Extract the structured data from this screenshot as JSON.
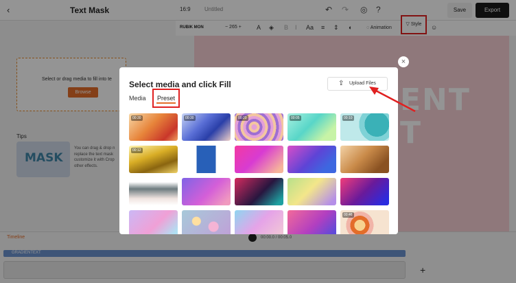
{
  "app": {
    "title": "Text Mask",
    "aspect_ratio": "16:9",
    "doc_name": "Untitled",
    "save_label": "Save",
    "export_label": "Export"
  },
  "left_panel": {
    "drop_text": "Select or drag media to fill into te",
    "browse_label": "Browse",
    "tips_title": "Tips",
    "tips_card_text": "MASK",
    "tips_text": "You can drag & drop n replace the text mask customize it with Crop other effects."
  },
  "text_toolbar": {
    "font": "RUBIK MON",
    "minus": "−",
    "size": "265",
    "plus": "+",
    "animation_label": "Animation",
    "style_label": "Style"
  },
  "canvas": {
    "text_line1": "ENT",
    "text_line2": "T"
  },
  "timeline": {
    "tools_label": "Timeline",
    "time": "00:00.0 / 00:05.0",
    "track_label": "GRADIENTEXT"
  },
  "modal": {
    "title": "Select media and click Fill",
    "upload_label": "Upload Files",
    "close_glyph": "×",
    "tabs": [
      {
        "label": "Media"
      },
      {
        "label": "Preset"
      }
    ],
    "tiles": [
      {
        "duration": "00:30",
        "bg": "linear-gradient(135deg,#f7d8a8,#e7843a 45%,#c9362a 80%,#f0a060)"
      },
      {
        "duration": "00:30",
        "bg": "linear-gradient(135deg,#c7d4f5,#5a6fd6 40%,#2a3fa8 65%,#f0d0c8)"
      },
      {
        "duration": "00:20",
        "bg": "repeating-radial-gradient(circle at 40% 50%,#e3a0d8 0 4px,#f3c6a0 4px 8px,#9f6fd2 8px 12px)"
      },
      {
        "duration": "00:05",
        "bg": "linear-gradient(135deg,#a8f0e0,#58d6c8 45%,#c7f3a6 80%)"
      },
      {
        "duration": "00:10",
        "bg": "radial-gradient(circle at 75% 40%,#3ab1b7 0 18px,#7fd2d6 18px 26px,#bfe9ea 26px)"
      },
      {
        "duration": "00:12",
        "bg": "linear-gradient(160deg,#fff4b0,#d9ae26 40%,#8a6510 70%,#f1d46a)"
      },
      {
        "duration": "",
        "bg": "linear-gradient(90deg,#ffffff 0 30%,#2860b8 30% 70%,#ffffff 70%)"
      },
      {
        "duration": "",
        "bg": "linear-gradient(135deg,#f33aa1,#d83bd2 45%,#f6b59a 90%)"
      },
      {
        "duration": "",
        "bg": "linear-gradient(135deg,#d84ec8,#5d44d6 50%,#3d67e0 80%)"
      },
      {
        "duration": "",
        "bg": "linear-gradient(135deg,#f3d2a6,#c98a49 45%,#8a5222 80%)"
      },
      {
        "duration": "",
        "bg": "linear-gradient(180deg,#ffffff 0 15%,#6d7b7f 40%,#f0e4e0 75%,#ffffff 100%)"
      },
      {
        "duration": "",
        "bg": "linear-gradient(135deg,#7f63e6,#d45fd8 55%,#f09abf 90%)"
      },
      {
        "duration": "",
        "bg": "linear-gradient(135deg,#d42b5f,#28163f 55%,#1ea0a0 90%)"
      },
      {
        "duration": "",
        "bg": "linear-gradient(135deg,#b7e08a,#f3e68a 45%,#b58fe8 90%)"
      },
      {
        "duration": "",
        "bg": "linear-gradient(135deg,#f23d7a,#6a1a9a 50%,#2a2be0 90%)"
      },
      {
        "duration": "",
        "bg": "linear-gradient(135deg,#cbb8f5,#f0a0d6 55%,#b0e0f3 90%)"
      },
      {
        "duration": "",
        "bg": "radial-gradient(circle at 30% 40%,#ffe0a0 0 6px,transparent 7px),radial-gradient(circle at 65% 60%,#f5b4d5 0 7px,transparent 8px),linear-gradient(135deg,#a7c9d9,#c0a0d8)"
      },
      {
        "duration": "",
        "bg": "linear-gradient(135deg,#8fd5f0,#e5a3e8 50%,#f0c3d8 90%)"
      },
      {
        "duration": "",
        "bg": "linear-gradient(135deg,#f26a9a,#b23fc0 55%,#5f4ad8 90%)"
      },
      {
        "duration": "00:46",
        "bg": "radial-gradient(circle at 40% 55%,#f7d390 0 8px,#e36d2a 8px 14px,#f1b4a8 14px 20px,#f6e3d0 20px)"
      }
    ]
  },
  "colors": {
    "accent": "#e36d2a",
    "highlight_box": "#e02020",
    "export_bg": "#1b1b1b"
  }
}
